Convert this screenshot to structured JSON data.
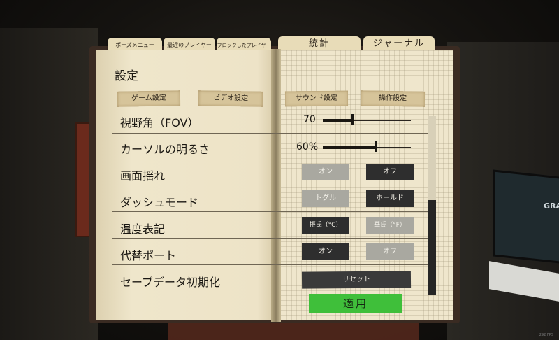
{
  "tabs": [
    {
      "label": "ポーズメニュー"
    },
    {
      "label": "最近のプレイヤー"
    },
    {
      "label": "ブロックしたプレイヤー"
    },
    {
      "label": "統計"
    },
    {
      "label": "ジャーナル"
    }
  ],
  "page_title": "設定",
  "categories": [
    {
      "label": "ゲーム設定"
    },
    {
      "label": "ビデオ設定"
    },
    {
      "label": "サウンド設定"
    },
    {
      "label": "操作設定"
    }
  ],
  "settings": {
    "fov": {
      "label": "視野角（FOV）",
      "value": "70",
      "level": 0.33
    },
    "brightness": {
      "label": "カーソルの明るさ",
      "value": "60%",
      "level": 0.6
    },
    "screen_shake": {
      "label": "画面揺れ",
      "on": "オン",
      "off": "オフ",
      "selected": "off"
    },
    "dash_mode": {
      "label": "ダッシュモード",
      "toggle": "トグル",
      "hold": "ホールド",
      "selected": "hold"
    },
    "temperature": {
      "label": "温度表記",
      "celsius": "摂氏（°C）",
      "fahrenheit": "華氏（°F）",
      "selected": "celsius"
    },
    "alt_port": {
      "label": "代替ポート",
      "on": "オン",
      "off": "オフ",
      "selected": "on"
    },
    "reset_save": {
      "label": "セーブデータ初期化",
      "button": "リセット"
    }
  },
  "apply_label": "適用",
  "fps": "292 FPS",
  "background": {
    "monitor_text": "GRA"
  }
}
